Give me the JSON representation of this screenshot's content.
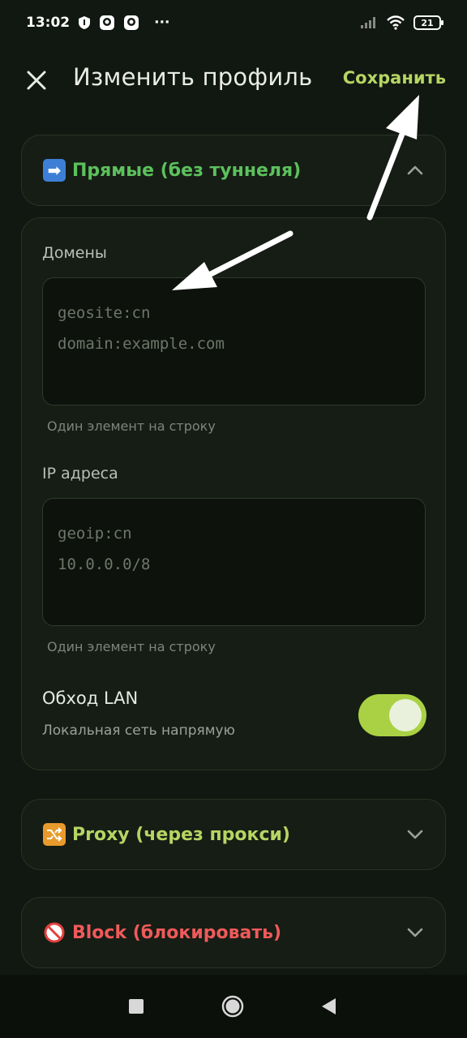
{
  "status_bar": {
    "time": "13:02",
    "more": "···",
    "battery": "21"
  },
  "app_bar": {
    "title": "Изменить профиль",
    "save_label": "Сохранить"
  },
  "sections": {
    "direct": {
      "emoji": "➡",
      "title": "Прямые (без туннеля)",
      "color": "#5cc15c",
      "expanded": true,
      "domains_label": "Домены",
      "domains_placeholder": "geosite:cn\ndomain:example.com",
      "domains_helper": "Один элемент на строку",
      "ip_label": "IP адреса",
      "ip_placeholder": "geoip:cn\n10.0.0.0/8",
      "ip_helper": "Один элемент на строку",
      "bypass_lan_title": "Обход LAN",
      "bypass_lan_subtitle": "Локальная сеть напрямую",
      "bypass_lan_enabled": true
    },
    "proxy": {
      "emoji": "🔀",
      "title": "Proxy (через прокси)",
      "color": "#b6d563",
      "expanded": false
    },
    "block": {
      "emoji": "🚫",
      "title": "Block (блокировать)",
      "color": "#ef5a5a",
      "expanded": false
    }
  },
  "colors": {
    "background": "#111711",
    "accent": "#b6d563",
    "toggle_on": "#aad143"
  }
}
